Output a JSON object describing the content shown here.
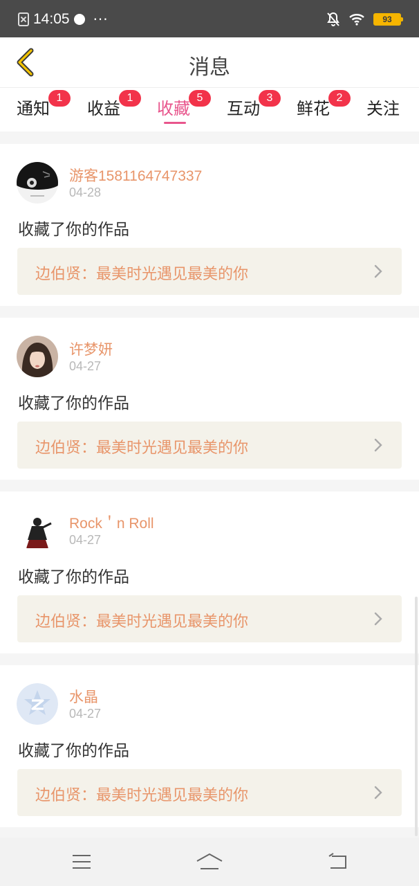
{
  "status_bar": {
    "time": "14:05",
    "more": "···",
    "battery": "93",
    "icons": [
      "sim-off-icon",
      "app-dot-icon",
      "bell-off-icon",
      "wifi-icon",
      "battery-icon"
    ]
  },
  "header": {
    "title": "消息",
    "back_icon": "chevron-left-icon"
  },
  "tabs": [
    {
      "label": "通知",
      "badge": "1"
    },
    {
      "label": "收益",
      "badge": "1"
    },
    {
      "label": "收藏",
      "badge": "5",
      "active": true
    },
    {
      "label": "互动",
      "badge": "3"
    },
    {
      "label": "鲜花",
      "badge": "2"
    },
    {
      "label": "关注",
      "badge": ""
    }
  ],
  "colors": {
    "accent": "#e8558c",
    "badge": "#f2334a",
    "username": "#e8956a",
    "work_bg": "#f4f2ea"
  },
  "messages": [
    {
      "username": "游客1581164747337",
      "date": "04-28",
      "action": "收藏了你的作品",
      "work": "边伯贤：最美时光遇见最美的你"
    },
    {
      "username": "许梦妍",
      "date": "04-27",
      "action": "收藏了你的作品",
      "work": "边伯贤：最美时光遇见最美的你"
    },
    {
      "username": "Rock＇n Roll",
      "date": "04-27",
      "action": "收藏了你的作品",
      "work": "边伯贤：最美时光遇见最美的你"
    },
    {
      "username": "水晶",
      "date": "04-27",
      "action": "收藏了你的作品",
      "work": "边伯贤：最美时光遇见最美的你"
    }
  ],
  "nav_bar": {
    "icons": [
      "menu-icon",
      "home-icon",
      "back-icon"
    ]
  }
}
